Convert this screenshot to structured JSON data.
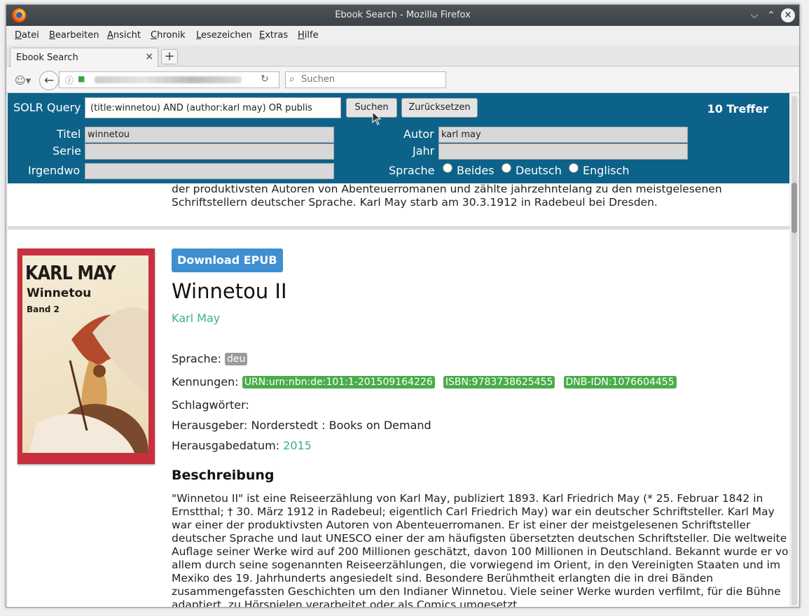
{
  "window": {
    "title": "Ebook Search - Mozilla Firefox"
  },
  "menu": [
    "Datei",
    "Bearbeiten",
    "Ansicht",
    "Chronik",
    "Lesezeichen",
    "Extras",
    "Hilfe"
  ],
  "tab": {
    "label": "Ebook Search",
    "close": "×",
    "new": "+"
  },
  "nav": {
    "search_placeholder": "Suchen"
  },
  "query": {
    "label": "SOLR Query",
    "value": "(title:winnetou) AND (author:karl may) OR publis",
    "search_button": "Suchen",
    "reset_button": "Zurücksetzen",
    "hits": "10 Treffer",
    "fields": {
      "title_label": "Titel",
      "title_value": "winnetou",
      "series_label": "Serie",
      "series_value": "",
      "anywhere_label": "Irgendwo",
      "anywhere_value": "",
      "author_label": "Autor",
      "author_value": "karl may",
      "year_label": "Jahr",
      "year_value": ""
    },
    "language": {
      "label": "Sprache",
      "options": [
        "Beides",
        "Deutsch",
        "Englisch"
      ]
    }
  },
  "previous_result": {
    "description_tail": "der produktivsten Autoren von Abenteuerromanen und zählte jahrzehntelang zu den meistgelesenen Schriftstellern deutscher Sprache. Karl May starb am 30.3.1912 in Radebeul bei Dresden."
  },
  "result": {
    "cover": {
      "author": "KARL MAY",
      "title": "Winnetou",
      "band": "Band 2"
    },
    "download_label": "Download EPUB",
    "title": "Winnetou II",
    "author": "Karl May",
    "language_label": "Sprache:",
    "language": "deu",
    "identifiers_label": "Kennungen:",
    "identifiers": [
      "URN:urn:nbn:de:101:1-201509164226",
      "ISBN:9783738625455",
      "DNB-IDN:1076604455"
    ],
    "keywords_label": "Schlagwörter:",
    "publisher_label": "Herausgeber:",
    "publisher": "Norderstedt : Books on Demand",
    "date_label": "Herausgabedatum:",
    "date": "2015",
    "description_heading": "Beschreibung",
    "description": "\"Winnetou II\" ist eine Reiseerzählung von Karl May, publiziert 1893. Karl Friedrich May (* 25. Februar 1842 in Ernstthal; † 30. März 1912 in Radebeul; eigentlich Carl Friedrich May) war ein deutscher Schriftsteller. Karl May war einer der produktivsten Autoren von Abenteuerromanen. Er ist einer der meistgelesenen Schriftsteller deutscher Sprache und laut UNESCO einer der am häufigsten übersetzten deutschen Schriftsteller. Die weltweite Auflage seiner Werke wird auf 200 Millionen geschätzt, davon 100 Millionen in Deutschland. Bekannt wurde er vor allem durch seine sogenannten Reiseerzählungen, die vorwiegend im Orient, in den Vereinigten Staaten und im Mexiko des 19. Jahrhunderts angesiedelt sind. Besondere Berühmtheit erlangten die in drei Bänden zusammengefassten Geschichten um den Indianer Winnetou. Viele seiner Werke wurden verfilmt, für die Bühne adaptiert, zu Hörspielen verarbeitet oder als Comics umgesetzt."
  }
}
